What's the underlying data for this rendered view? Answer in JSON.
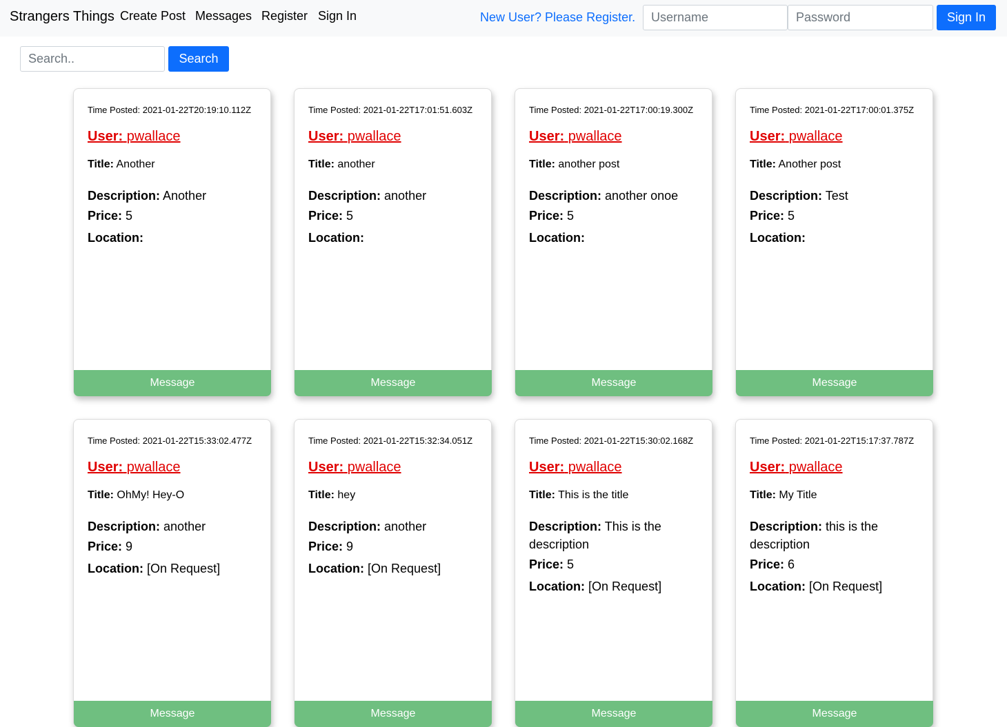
{
  "nav": {
    "brand": "Strangers Things",
    "links": [
      "Create Post",
      "Messages",
      "Register",
      "Sign In"
    ],
    "register_prompt": "New User? Please Register.",
    "username_placeholder": "Username",
    "password_placeholder": "Password",
    "signin_label": "Sign In"
  },
  "search": {
    "placeholder": "Search..",
    "button_label": "Search"
  },
  "labels": {
    "time_prefix": "Time Posted: ",
    "user": "User:",
    "title": "Title:",
    "description": "Description:",
    "price": "Price:",
    "location": "Location:",
    "message_button": "Message"
  },
  "posts": [
    {
      "time": "2021-01-22T20:19:10.112Z",
      "user": "pwallace",
      "title": "Another",
      "description": "Another",
      "price": "5",
      "location": ""
    },
    {
      "time": "2021-01-22T17:01:51.603Z",
      "user": "pwallace",
      "title": "another",
      "description": "another",
      "price": "5",
      "location": ""
    },
    {
      "time": "2021-01-22T17:00:19.300Z",
      "user": "pwallace",
      "title": "another post",
      "description": "another onoe",
      "price": "5",
      "location": ""
    },
    {
      "time": "2021-01-22T17:00:01.375Z",
      "user": "pwallace",
      "title": "Another post",
      "description": "Test",
      "price": "5",
      "location": ""
    },
    {
      "time": "2021-01-22T15:33:02.477Z",
      "user": "pwallace",
      "title": "OhMy! Hey-O",
      "description": "another",
      "price": "9",
      "location": "[On Request]"
    },
    {
      "time": "2021-01-22T15:32:34.051Z",
      "user": "pwallace",
      "title": "hey",
      "description": "another",
      "price": "9",
      "location": "[On Request]"
    },
    {
      "time": "2021-01-22T15:30:02.168Z",
      "user": "pwallace",
      "title": "This is the title",
      "description": "This is the description",
      "price": "5",
      "location": "[On Request]"
    },
    {
      "time": "2021-01-22T15:17:37.787Z",
      "user": "pwallace",
      "title": "My Title",
      "description": "this is the description",
      "price": "6",
      "location": "[On Request]"
    }
  ]
}
